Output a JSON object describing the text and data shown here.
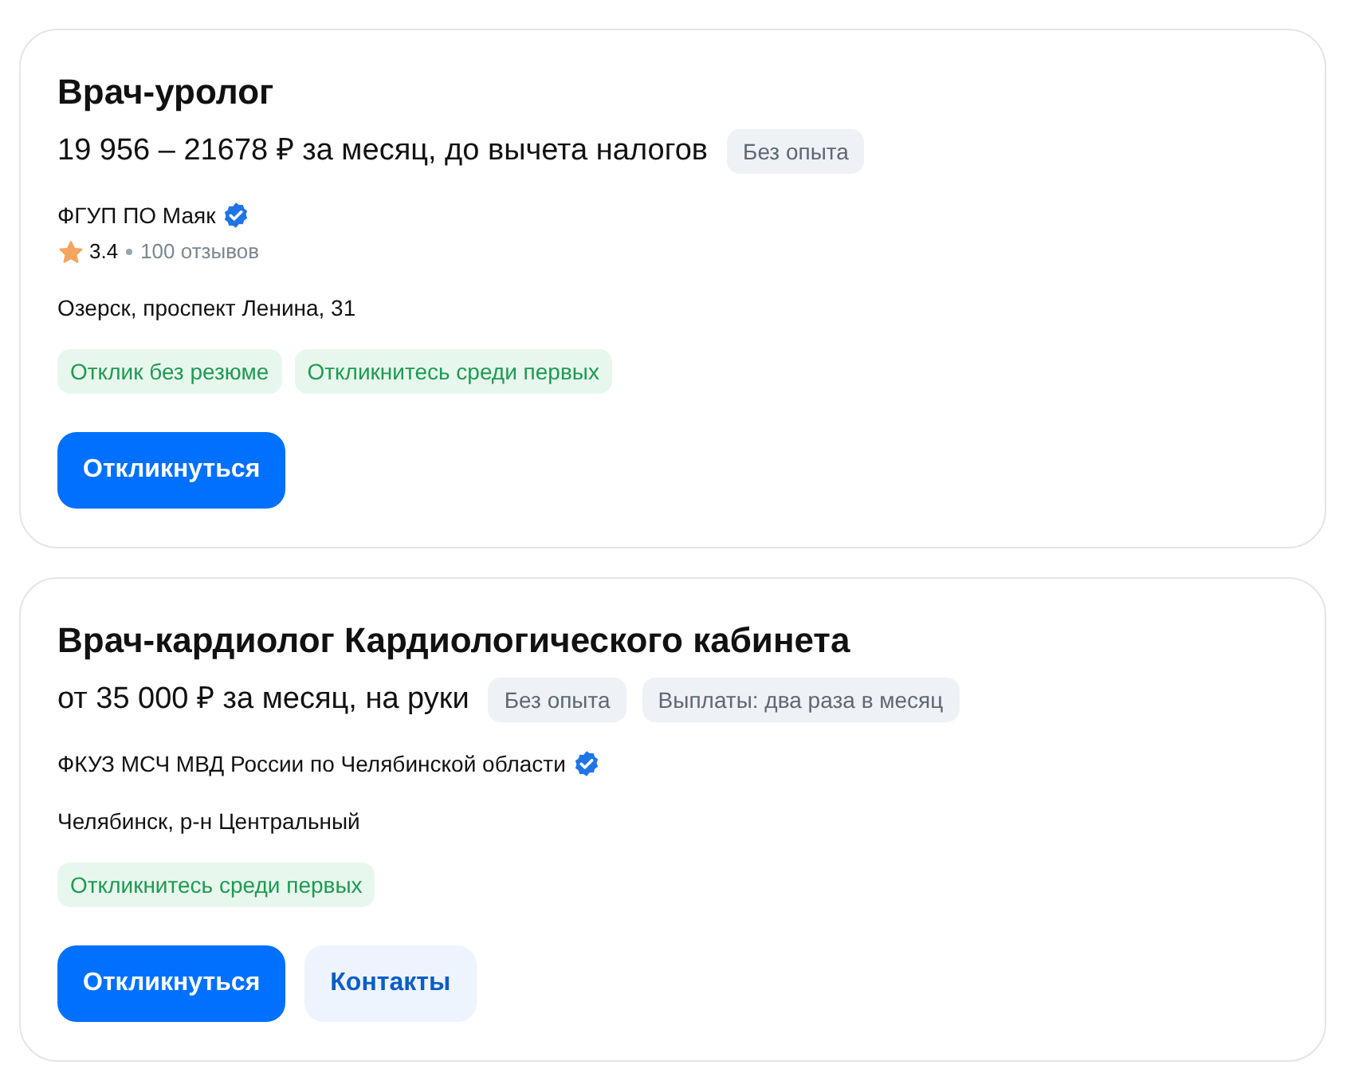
{
  "vacancies": [
    {
      "title": "Врач-уролог",
      "salary": "19 956 – 21678 ₽ за месяц, до вычета налогов",
      "info_tags": [
        "Без опыта"
      ],
      "company": "ФГУП ПО Маяк",
      "verified": true,
      "rating": {
        "score": "3.4",
        "reviews": "100 отзывов"
      },
      "address": "Озерск, проспект Ленина, 31",
      "highlights": [
        "Отклик без резюме",
        "Откликнитесь среди первых"
      ],
      "buttons": [
        {
          "label": "Откликнуться",
          "kind": "primary"
        }
      ]
    },
    {
      "title": "Врач-кардиолог Кардиологического кабинета",
      "salary": "от 35 000 ₽ за месяц, на руки",
      "info_tags": [
        "Без опыта",
        "Выплаты: два раза в месяц"
      ],
      "company": "ФКУЗ МСЧ МВД России по Челябинской области",
      "verified": true,
      "address": "Челябинск, р-н Центральный",
      "highlights": [
        "Откликнитесь среди первых"
      ],
      "buttons": [
        {
          "label": "Откликнуться",
          "kind": "primary"
        },
        {
          "label": "Контакты",
          "kind": "secondary"
        }
      ]
    }
  ]
}
